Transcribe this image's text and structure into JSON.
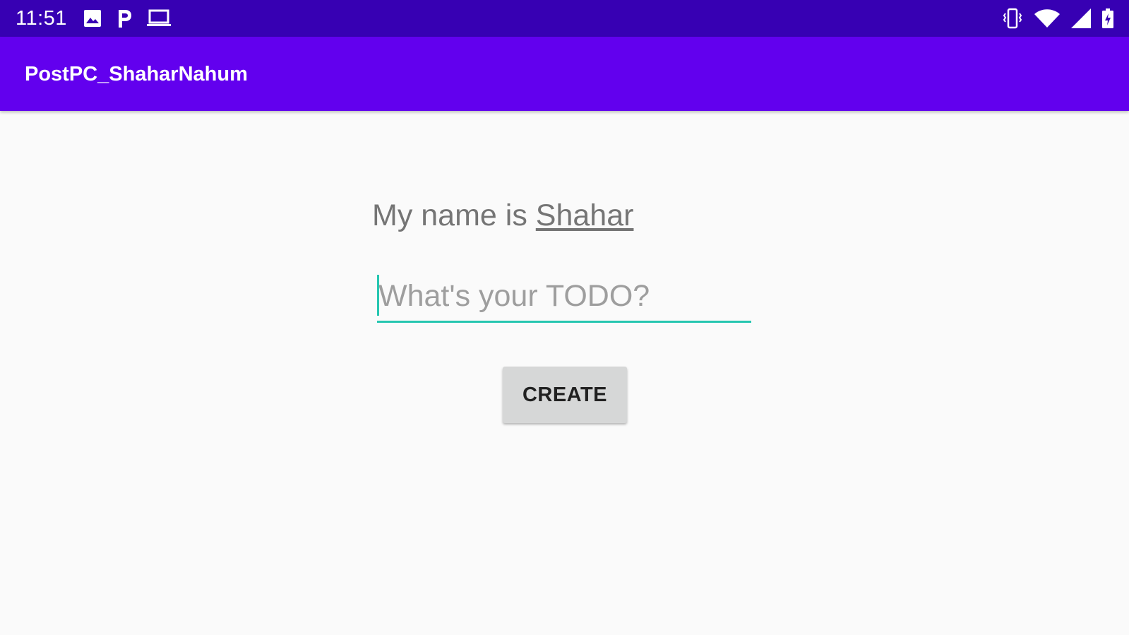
{
  "status_bar": {
    "time": "11:51",
    "left_icons": [
      "image-icon",
      "parking-icon",
      "laptop-icon"
    ],
    "right_icons": [
      "vibrate-icon",
      "wifi-icon",
      "signal-icon",
      "battery-charging-icon"
    ]
  },
  "app_bar": {
    "title": "PostPC_ShaharNahum"
  },
  "main": {
    "name_prefix": "My name is ",
    "name_value": "Shahar",
    "todo_placeholder": "What's your TODO?",
    "todo_value": "",
    "create_label": "CREATE"
  },
  "colors": {
    "status_bar": "#3700b3",
    "app_bar": "#6200ee",
    "accent": "#26c6b0",
    "background": "#fafafa",
    "button": "#d6d7d7"
  }
}
